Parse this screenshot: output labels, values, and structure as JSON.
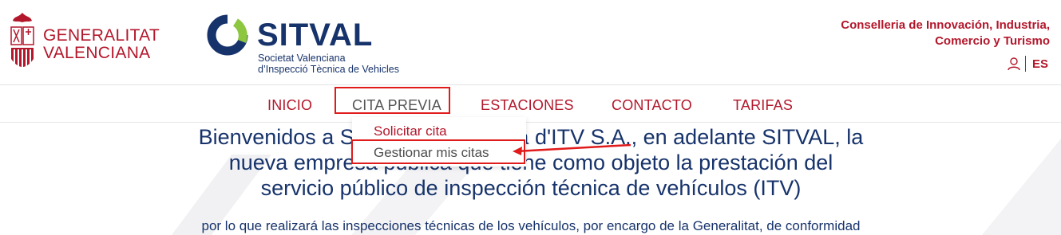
{
  "header": {
    "gv_line1": "GENERALITAT",
    "gv_line2": "VALENCIANA",
    "sitval_name": "SITVAL",
    "sitval_sub1": "Societat Valenciana",
    "sitval_sub2": "d’Inspecció Tècnica de Vehicles",
    "conselleria_line1": "Conselleria de Innovación, Industria,",
    "conselleria_line2": "Comercio y Turismo",
    "lang": "ES"
  },
  "nav": {
    "items": [
      {
        "label": "INICIO"
      },
      {
        "label": "CITA PREVIA"
      },
      {
        "label": "ESTACIONES"
      },
      {
        "label": "CONTACTO"
      },
      {
        "label": "TARIFAS"
      }
    ]
  },
  "dropdown": {
    "items": [
      {
        "label": "Solicitar cita"
      },
      {
        "label": "Gestionar mis citas"
      }
    ]
  },
  "main": {
    "welcome_line1": "Bienvenidos a Societat Valenciana d'ITV S.A., en adelante SITVAL, la",
    "welcome_line2": "nueva empresa pública que tiene como objeto la prestación del",
    "welcome_line3": "servicio público de inspección técnica de vehículos (ITV)",
    "paragraph": "por lo que realizará las inspecciones técnicas de los vehículos, por encargo de la Generalitat, de conformidad"
  },
  "colors": {
    "brand_red": "#b3172b",
    "brand_navy": "#17336b",
    "sitval_green": "#8dc63f",
    "highlight": "#e11a1a"
  }
}
